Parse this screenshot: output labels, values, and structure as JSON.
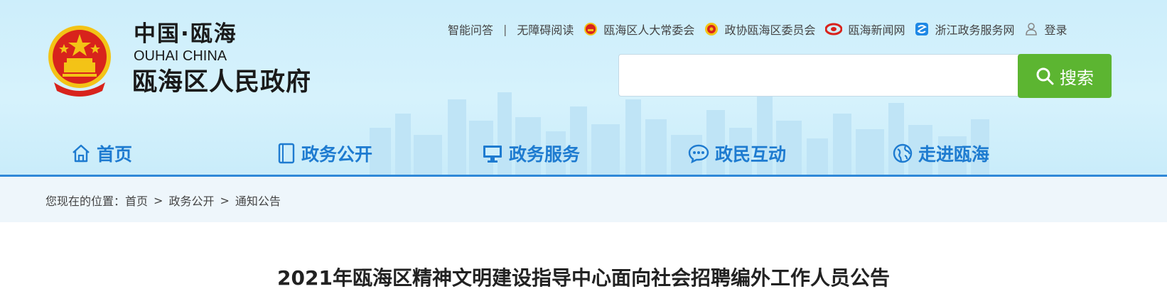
{
  "logo": {
    "cn": "中国·瓯海",
    "en": "OUHAI CHINA",
    "name": "瓯海区人民政府"
  },
  "toplinks": {
    "qa": "智能问答",
    "separator": "|",
    "accessible": "无障碍阅读",
    "npc": "瓯海区人大常委会",
    "cppcc": "政协瓯海区委员会",
    "news": "瓯海新闻网",
    "zjzwfw": "浙江政务服务网",
    "login": "登录"
  },
  "search": {
    "value": "",
    "button_label": "搜索",
    "icon": "search-icon"
  },
  "nav": [
    {
      "label": "首页",
      "icon": "home-icon"
    },
    {
      "label": "政务公开",
      "icon": "document-icon"
    },
    {
      "label": "政务服务",
      "icon": "monitor-icon"
    },
    {
      "label": "政民互动",
      "icon": "chat-icon"
    },
    {
      "label": "走进瓯海",
      "icon": "globe-icon"
    }
  ],
  "breadcrumb": {
    "prefix": "您现在的位置：",
    "items": [
      "首页",
      "政务公开",
      "通知公告"
    ],
    "separator": ">"
  },
  "article": {
    "title": "2021年瓯海区精神文明建设指导中心面向社会招聘编外工作人员公告"
  },
  "colors": {
    "accent": "#1e7bd0",
    "search_button": "#5cb531",
    "header_bg": "#cdeefb",
    "emblem_red": "#d8231c",
    "emblem_gold": "#f3c316"
  }
}
